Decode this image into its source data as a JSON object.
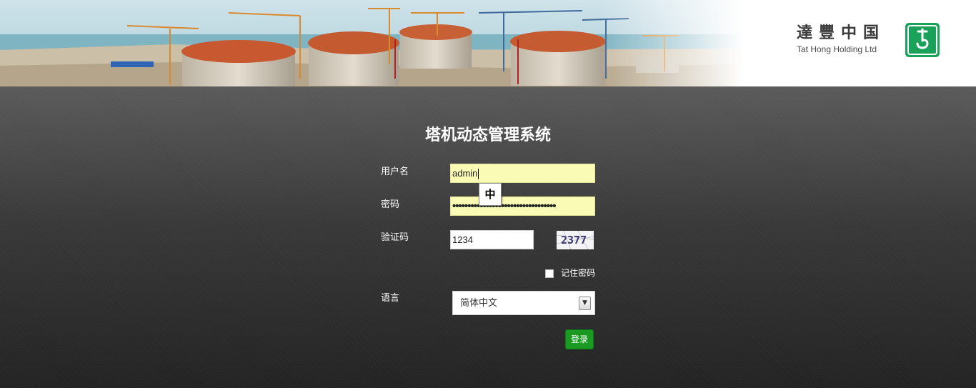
{
  "header": {
    "brand_cn": "達豐中国",
    "brand_en": "Tat Hong Holding Ltd",
    "logo_icon": "hook-icon"
  },
  "login": {
    "title": "塔机动态管理系统",
    "username_label": "用户名",
    "username_value": "admin",
    "password_label": "密码",
    "password_masked": "••••••••••••••••••••••••••••••••••",
    "captcha_label": "验证码",
    "captcha_value": "1234",
    "captcha_image_text": "2377",
    "ime_indicator": "中",
    "remember_label": "记住密码",
    "language_label": "语言",
    "language_selected": "简体中文",
    "submit_label": "登录"
  },
  "colors": {
    "input_autofill": "#fafbb4",
    "button": "#1a9a23",
    "logo": "#1aa15a"
  }
}
